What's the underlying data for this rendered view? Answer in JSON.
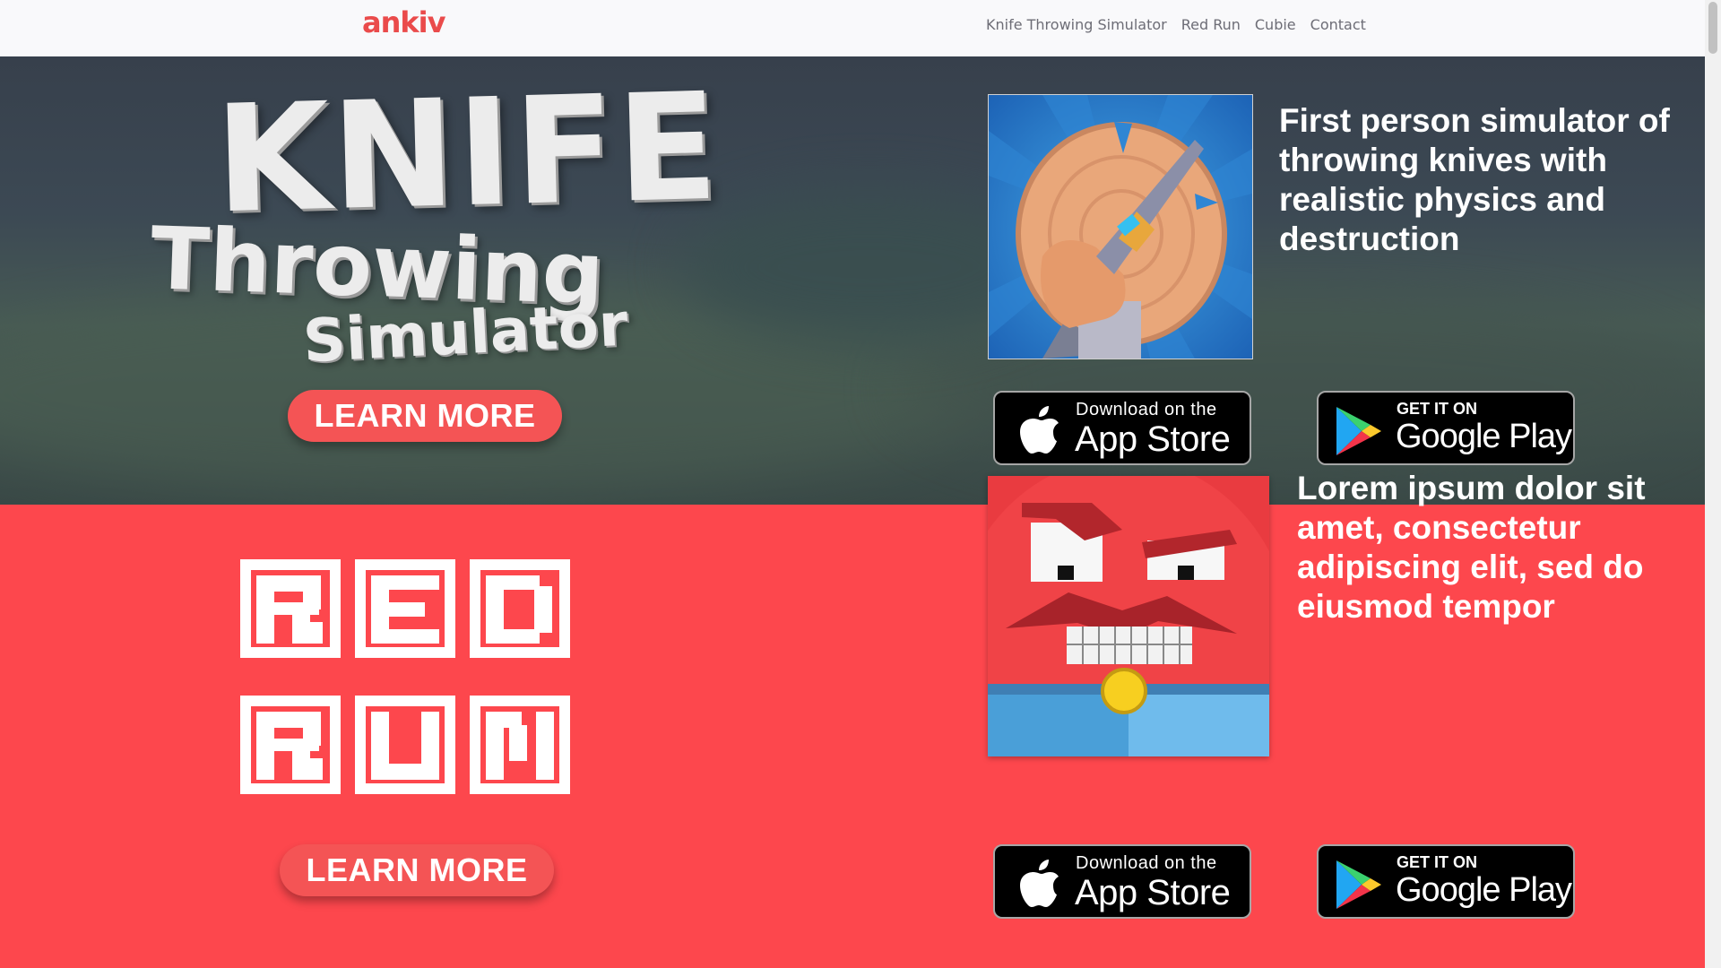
{
  "nav": {
    "logo": "ankiv",
    "links": [
      "Knife Throwing Simulator",
      "Red Run",
      "Cubie",
      "Contact"
    ]
  },
  "section1": {
    "game_title_line1": "KNIFE",
    "game_title_line2": "Throwing",
    "game_title_line3": "Simulator",
    "learn_more": "LEARN MORE",
    "tagline": "First person simulator of throwing knives with realistic physics and destruction",
    "appstore_small": "Download on the",
    "appstore_big": "App Store",
    "google_small": "GET IT ON",
    "google_big": "Google Play"
  },
  "section2": {
    "learn_more": "LEARN MORE",
    "tagline": "Lorem ipsum dolor sit amet, consectetur adipiscing elit, sed do eiusmod tempor",
    "appstore_small": "Download on the",
    "appstore_big": "App Store",
    "google_small": "GET IT ON",
    "google_big": "Google Play"
  },
  "colors": {
    "accent_red": "#fd474d",
    "button_red": "#f45455",
    "logo_red": "#ea4b4b",
    "hero_dark": "#3c4954"
  },
  "icons": [
    "apple-icon",
    "google-play-icon"
  ]
}
